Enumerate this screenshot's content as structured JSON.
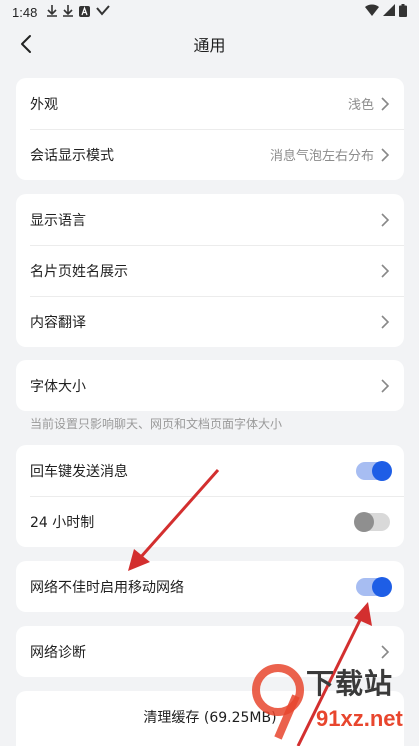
{
  "status_bar": {
    "time": "1:48",
    "icons_left": [
      "download-icon",
      "download-icon",
      "a-box-icon",
      "sync-icon"
    ],
    "icons_right": [
      "wifi-icon",
      "signal-icon",
      "battery-icon"
    ]
  },
  "header": {
    "title": "通用"
  },
  "group1": {
    "appearance_label": "外观",
    "appearance_value": "浅色",
    "chat_mode_label": "会话显示模式",
    "chat_mode_value": "消息气泡左右分布"
  },
  "group2": {
    "language_label": "显示语言",
    "card_name_label": "名片页姓名展示",
    "translate_label": "内容翻译"
  },
  "group3": {
    "font_size_label": "字体大小",
    "hint": "当前设置只影响聊天、网页和文档页面字体大小"
  },
  "group4": {
    "enter_send_label": "回车键发送消息",
    "enter_send_on": true,
    "clock_label": "24 小时制",
    "clock_on": false
  },
  "group5": {
    "mobile_net_label": "网络不佳时启用移动网络",
    "mobile_net_on": true
  },
  "group6": {
    "diagnose_label": "网络诊断"
  },
  "group7": {
    "clear_cache_label": "清理缓存 (69.25MB)"
  },
  "watermark": {
    "text_cn": "下载站",
    "text_en": "91xz.net"
  },
  "colors": {
    "accent": "#1e5ee6",
    "annotation_arrow": "#d32f2f"
  }
}
